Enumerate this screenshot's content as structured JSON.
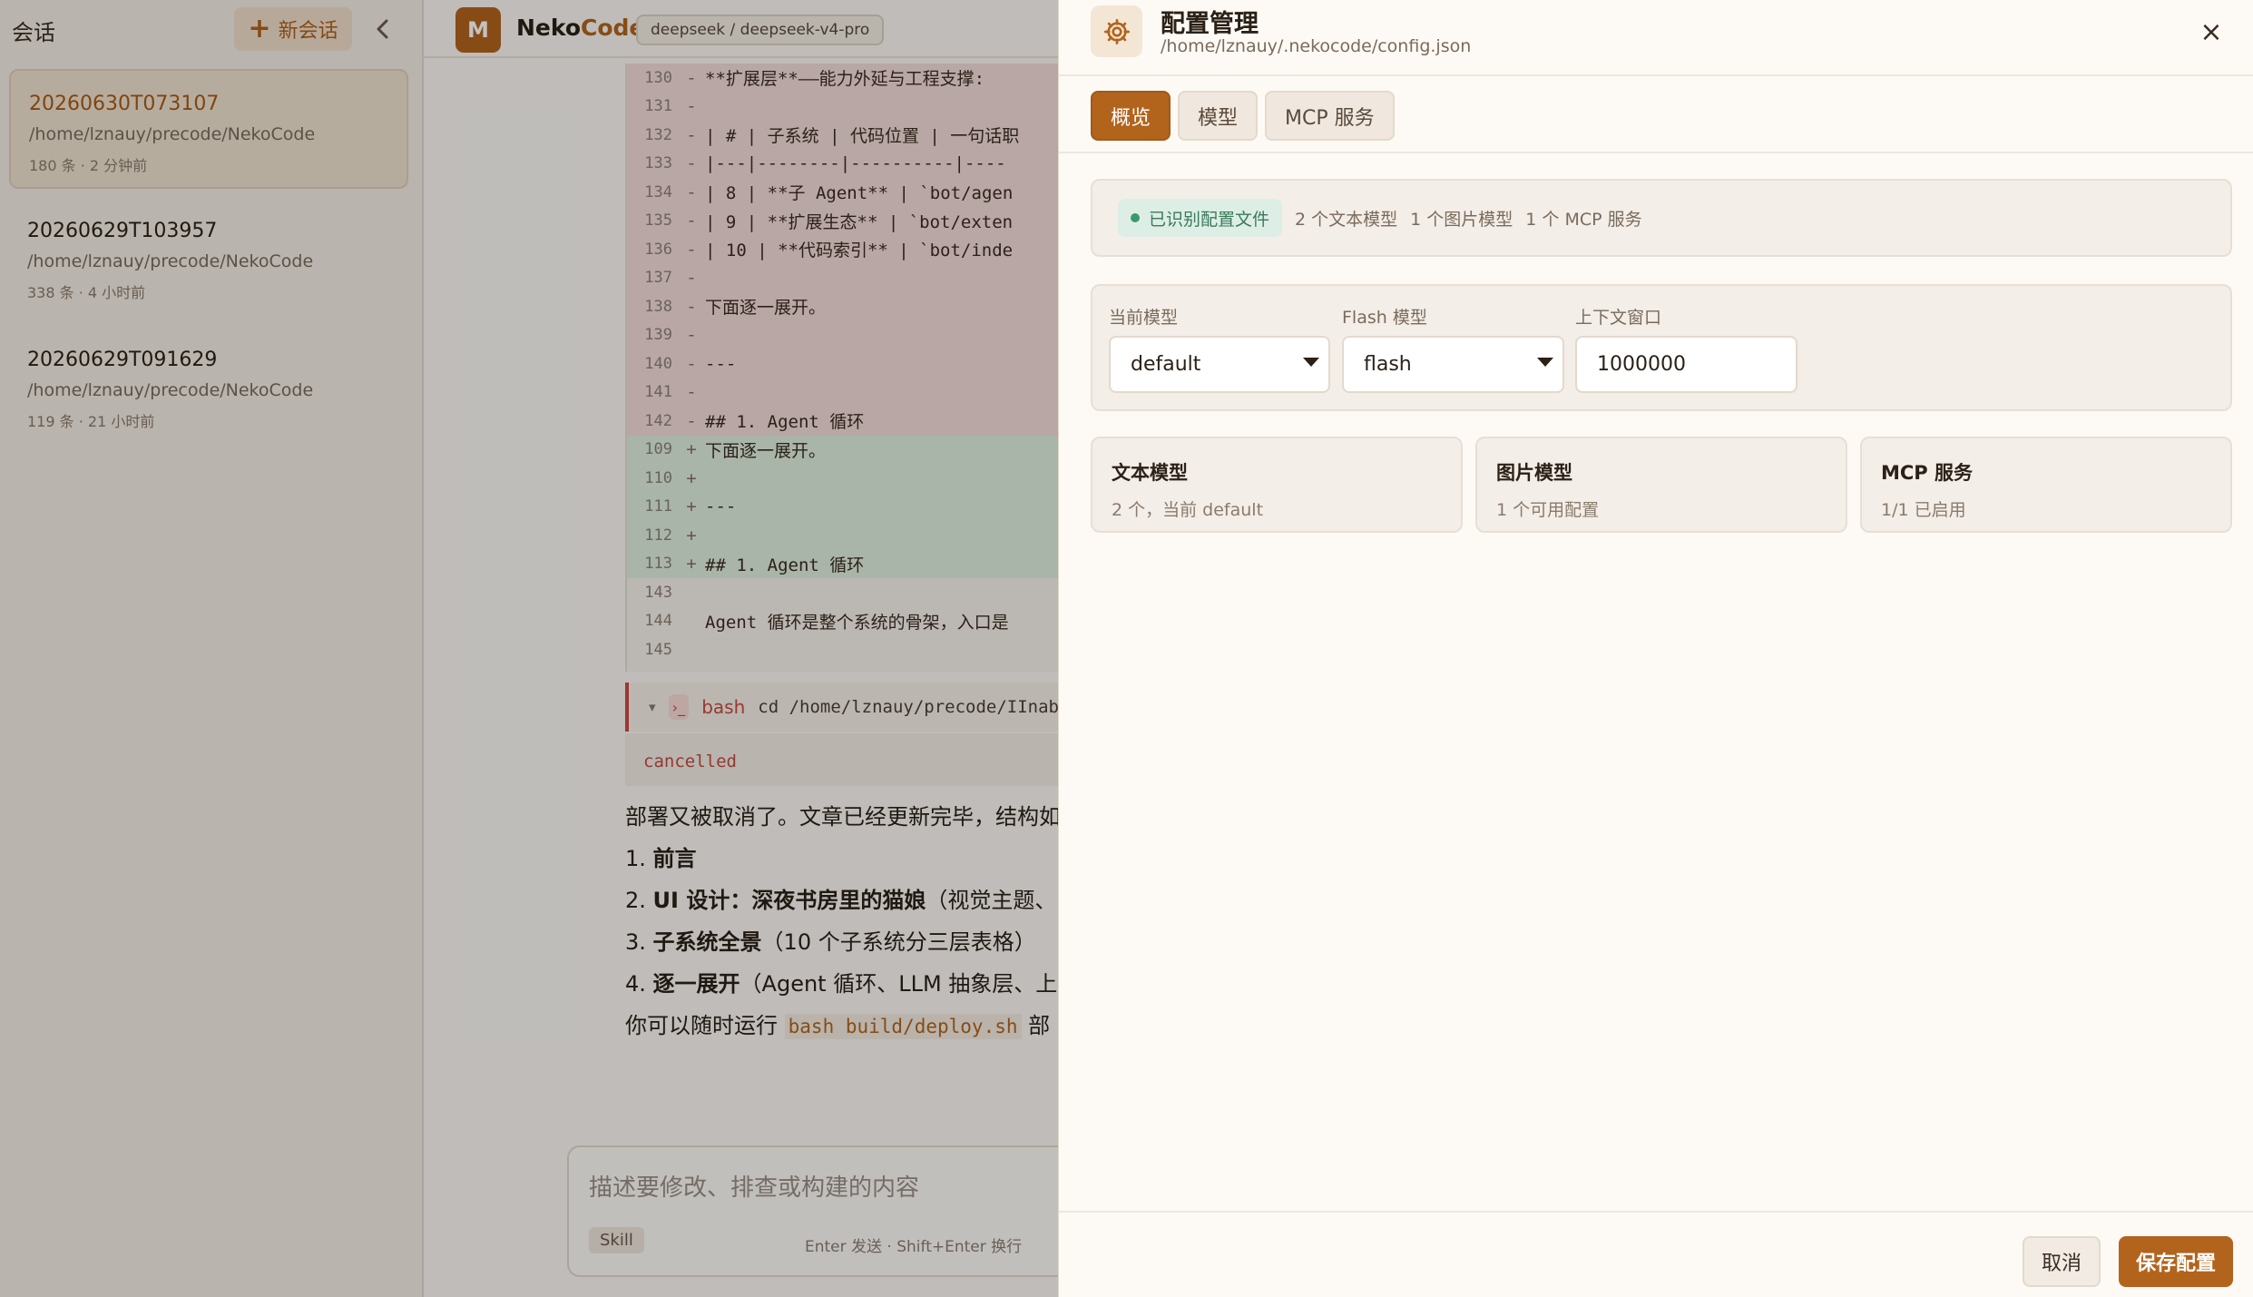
{
  "sidebar": {
    "title": "会话",
    "new_button": "新会话",
    "sessions": [
      {
        "title": "20260630T073107",
        "path": "/home/lznauy/precode/NekoCode",
        "meta": "180 条  ·  2 分钟前"
      },
      {
        "title": "20260629T103957",
        "path": "/home/lznauy/precode/NekoCode",
        "meta": "338 条  ·  4 小时前"
      },
      {
        "title": "20260629T091629",
        "path": "/home/lznauy/precode/NekoCode",
        "meta": "119 条  ·  21 小时前"
      }
    ]
  },
  "header": {
    "logo_letter": "M",
    "brand_a": "Neko",
    "brand_b": "Code",
    "model": "deepseek / deepseek-v4-pro"
  },
  "diff": {
    "rows": [
      {
        "n": "130",
        "s": "-",
        "t": "**扩展层**——能力外延与工程支撑:",
        "k": "del"
      },
      {
        "n": "131",
        "s": "-",
        "t": "",
        "k": "del"
      },
      {
        "n": "132",
        "s": "-",
        "t": "| # | 子系统 | 代码位置 | 一句话职",
        "k": "del"
      },
      {
        "n": "133",
        "s": "-",
        "t": "|---|--------|----------|----",
        "k": "del"
      },
      {
        "n": "134",
        "s": "-",
        "t": "| 8 | **子 Agent** | `bot/agen",
        "k": "del"
      },
      {
        "n": "135",
        "s": "-",
        "t": "| 9 | **扩展生态** | `bot/exten",
        "k": "del"
      },
      {
        "n": "136",
        "s": "-",
        "t": "| 10 | **代码索引** | `bot/inde",
        "k": "del"
      },
      {
        "n": "137",
        "s": "-",
        "t": "",
        "k": "del"
      },
      {
        "n": "138",
        "s": "-",
        "t": "下面逐一展开。",
        "k": "del"
      },
      {
        "n": "139",
        "s": "-",
        "t": "",
        "k": "del"
      },
      {
        "n": "140",
        "s": "-",
        "t": "---",
        "k": "del"
      },
      {
        "n": "141",
        "s": "-",
        "t": "",
        "k": "del"
      },
      {
        "n": "142",
        "s": "-",
        "t": "## 1. Agent 循环",
        "k": "del"
      },
      {
        "n": "109",
        "s": "+",
        "t": "下面逐一展开。",
        "k": "add"
      },
      {
        "n": "110",
        "s": "+",
        "t": "",
        "k": "add"
      },
      {
        "n": "111",
        "s": "+",
        "t": "---",
        "k": "add"
      },
      {
        "n": "112",
        "s": "+",
        "t": "",
        "k": "add"
      },
      {
        "n": "113",
        "s": "+",
        "t": "## 1. Agent 循环",
        "k": "add"
      },
      {
        "n": "143",
        "s": "",
        "t": "",
        "k": "ctx"
      },
      {
        "n": "144",
        "s": "",
        "t": "Agent 循环是整个系统的骨架，入口是",
        "k": "ctx"
      },
      {
        "n": "145",
        "s": "",
        "t": "",
        "k": "ctx"
      }
    ]
  },
  "tool": {
    "caret": "▾",
    "icon": "›_",
    "label": "bash",
    "command": "cd /home/lznauy/precode/IInab",
    "status": "cancelled"
  },
  "message": {
    "intro": "部署又被取消了。文章已经更新完毕，结构如",
    "items": [
      {
        "num": "1.",
        "bold": "前言",
        "rest": ""
      },
      {
        "num": "2.",
        "bold": "UI 设计：深夜书房里的猫娘",
        "rest": "（视觉主题、"
      },
      {
        "num": "3.",
        "bold": "子系统全景",
        "rest": "（10 个子系统分三层表格）"
      },
      {
        "num": "4.",
        "bold": "逐一展开",
        "rest": "（Agent 循环、LLM 抽象层、上下"
      }
    ],
    "outro_a": "你可以随时运行 ",
    "outro_code": "bash build/deploy.sh",
    "outro_b": " 部"
  },
  "composer": {
    "placeholder": "描述要修改、排查或构建的内容",
    "skill": "Skill",
    "hint": "Enter 发送 · Shift+Enter 换行"
  },
  "panel": {
    "title": "配置管理",
    "path": "/home/lznauy/.nekocode/config.json",
    "icon": "gear-icon",
    "close": "×",
    "tabs": [
      "概览",
      "模型",
      "MCP 服务"
    ],
    "active_tab": 0,
    "status": {
      "badge": "已识别配置文件",
      "items": [
        "2 个文本模型",
        "1 个图片模型",
        "1 个 MCP 服务"
      ]
    },
    "fields": {
      "current_model_label": "当前模型",
      "current_model_value": "default",
      "flash_model_label": "Flash 模型",
      "flash_model_value": "flash",
      "context_label": "上下文窗口",
      "context_value": "1000000"
    },
    "cards": [
      {
        "title": "文本模型",
        "sub": "2 个，当前 default"
      },
      {
        "title": "图片模型",
        "sub": "1 个可用配置"
      },
      {
        "title": "MCP 服务",
        "sub": "1/1 已启用"
      }
    ],
    "cancel": "取消",
    "save": "保存配置"
  },
  "colors": {
    "accent": "#b2641d",
    "delete_bg": "#f2dcd9",
    "add_bg": "#ddeedd",
    "status_green": "#3a9a6a"
  }
}
